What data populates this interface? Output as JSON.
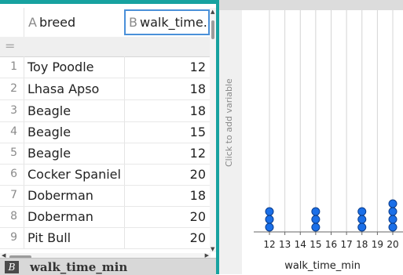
{
  "sheet": {
    "columns": [
      {
        "letter": "A",
        "name": "breed"
      },
      {
        "letter": "B",
        "name": "walk_time..."
      }
    ],
    "formula_symbol": "=",
    "rows": [
      {
        "num": "1",
        "breed": "Toy Poodle",
        "walk": "12"
      },
      {
        "num": "2",
        "breed": "Lhasa Apso",
        "walk": "18"
      },
      {
        "num": "3",
        "breed": "Beagle",
        "walk": "18"
      },
      {
        "num": "4",
        "breed": "Beagle",
        "walk": "15"
      },
      {
        "num": "5",
        "breed": "Beagle",
        "walk": "12"
      },
      {
        "num": "6",
        "breed": "Cocker Spaniel",
        "walk": "20"
      },
      {
        "num": "7",
        "breed": "Doberman",
        "walk": "18"
      },
      {
        "num": "8",
        "breed": "Doberman",
        "walk": "20"
      },
      {
        "num": "9",
        "breed": "Pit Bull",
        "walk": "20"
      }
    ],
    "footer": {
      "badge": "B",
      "variable": "walk_time_min"
    }
  },
  "graph": {
    "side_label": "Click to add variable"
  },
  "chart_data": {
    "type": "scatter",
    "subtype": "dot plot",
    "xlabel": "walk_time_min",
    "ticks": [
      12,
      13,
      14,
      15,
      16,
      17,
      18,
      19,
      20
    ],
    "xlim": [
      12,
      20
    ],
    "points": [
      {
        "x": 12,
        "count": 3
      },
      {
        "x": 15,
        "count": 3
      },
      {
        "x": 18,
        "count": 3
      },
      {
        "x": 20,
        "count": 4
      }
    ],
    "dot_color": "#1a6fe8",
    "gridlines": true
  }
}
